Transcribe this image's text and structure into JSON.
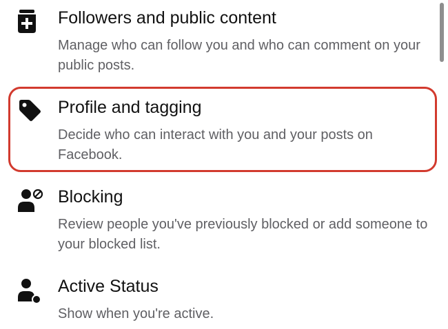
{
  "settings": {
    "items": [
      {
        "icon": "followers-box-plus-icon",
        "title": "Followers and public content",
        "description": "Manage who can follow you and who can comment on your public posts."
      },
      {
        "icon": "tag-icon",
        "title": "Profile and tagging",
        "description": "Decide who can interact with you and your posts on Facebook.",
        "highlighted": true
      },
      {
        "icon": "person-blocked-icon",
        "title": "Blocking",
        "description": "Review people you've previously blocked or add someone to your blocked list."
      },
      {
        "icon": "person-active-status-icon",
        "title": "Active Status",
        "description": "Show when you're active."
      }
    ]
  },
  "colors": {
    "highlight_border": "#d23a2e",
    "title_text": "#111111",
    "description_text": "#5f5f63",
    "icon": "#111111"
  }
}
